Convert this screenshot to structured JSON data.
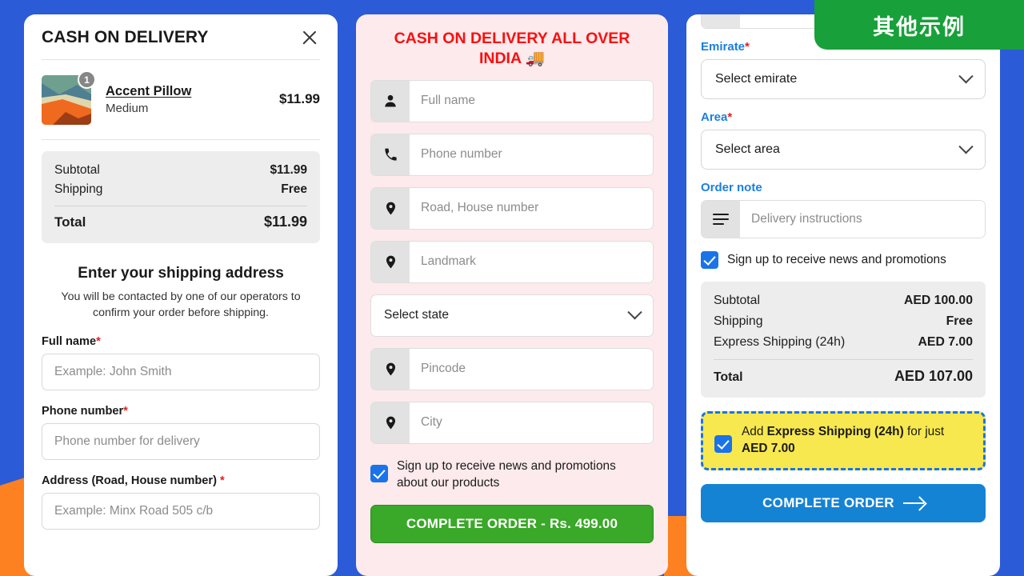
{
  "badge": {
    "text": "其他示例"
  },
  "colors": {
    "background_blue": "#2b5bd7",
    "accent_orange": "#fd8021",
    "panel2_bg": "#fdeaec",
    "title_red": "#fa0f0f",
    "label_blue": "#1a7fe0",
    "green_button": "#3aa828",
    "blue_button": "#1583d4",
    "upsell_yellow": "#f7e84f",
    "checkbox_blue": "#1a73e8",
    "badge_green": "#18a03a"
  },
  "panel1": {
    "title": "CASH ON DELIVERY",
    "close_label": "×",
    "item": {
      "quantity": "1",
      "name": "Accent Pillow",
      "variant": "Medium",
      "price": "$11.99"
    },
    "summary": {
      "rows": [
        {
          "label": "Subtotal",
          "value": "$11.99"
        },
        {
          "label": "Shipping",
          "value": "Free"
        }
      ],
      "total_label": "Total",
      "total_value": "$11.99"
    },
    "heading": "Enter your shipping address",
    "subtext": "You will be contacted by one of our operators to confirm your order before shipping.",
    "fields": [
      {
        "label": "Full name",
        "required": "*",
        "placeholder": "Example: John Smith"
      },
      {
        "label": "Phone number",
        "required": "*",
        "placeholder": "Phone number for delivery"
      },
      {
        "label": "Address (Road, House number)",
        "required": "*",
        "placeholder": "Example: Minx Road 505 c/b"
      }
    ]
  },
  "panel2": {
    "title": "CASH ON DELIVERY ALL OVER INDIA 🚚",
    "fields": [
      {
        "icon": "person-icon",
        "placeholder": "Full name"
      },
      {
        "icon": "phone-icon",
        "placeholder": "Phone number"
      },
      {
        "icon": "location-pin-icon",
        "placeholder": "Road, House number"
      },
      {
        "icon": "location-pin-icon",
        "placeholder": "Landmark"
      }
    ],
    "state_select": "Select state",
    "fields2": [
      {
        "icon": "location-pin-icon",
        "placeholder": "Pincode"
      },
      {
        "icon": "location-pin-icon",
        "placeholder": "City"
      }
    ],
    "newsletter_label": "Sign up to receive news and promotions about our products",
    "newsletter_checked": true,
    "submit_label": "COMPLETE ORDER - Rs. 499.00"
  },
  "panel3": {
    "emirate_label": "Emirate",
    "emirate_required": "*",
    "emirate_value": "Select emirate",
    "area_label": "Area",
    "area_required": "*",
    "area_value": "Select area",
    "order_note_label": "Order note",
    "order_note_placeholder": "Delivery instructions",
    "newsletter_label": "Sign up to receive news and promotions",
    "newsletter_checked": true,
    "summary": {
      "rows": [
        {
          "label": "Subtotal",
          "value": "AED 100.00"
        },
        {
          "label": "Shipping",
          "value": "Free"
        },
        {
          "label": "Express Shipping (24h)",
          "value": "AED 7.00"
        }
      ],
      "total_label": "Total",
      "total_value": "AED 107.00"
    },
    "upsell": {
      "prefix": "Add ",
      "bold1": "Express Shipping (24h)",
      "middle": " for just ",
      "bold2": "AED 7.00",
      "checked": true
    },
    "submit_label": "COMPLETE ORDER"
  }
}
